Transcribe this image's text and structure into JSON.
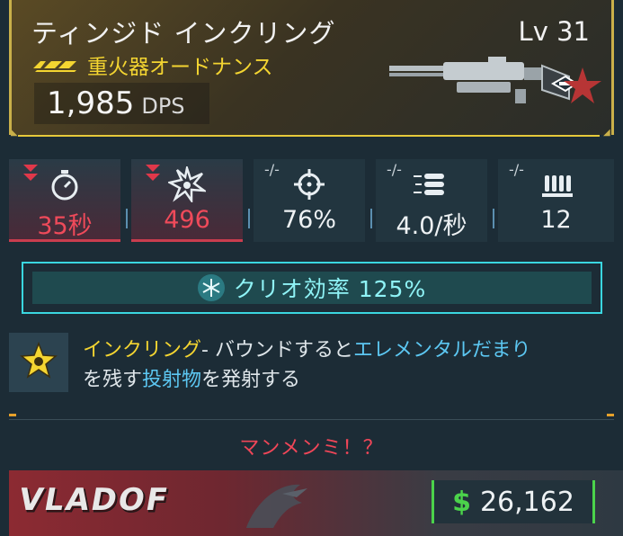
{
  "header": {
    "title": "ティンジド インクリング",
    "level": "Lv 31",
    "rarity_label": "重火器オードナンス",
    "dps_value": "1,985",
    "dps_unit": "DPS",
    "accent_color": "#e6c93a"
  },
  "stats": [
    {
      "id": "reload",
      "indicator": "down",
      "icon": "stopwatch-icon",
      "value": "35秒"
    },
    {
      "id": "damage",
      "indicator": "down",
      "icon": "burst-icon",
      "value": "496"
    },
    {
      "id": "accuracy",
      "indicator": "-/-",
      "icon": "crosshair-icon",
      "value": "76%"
    },
    {
      "id": "fire_rate",
      "indicator": "-/-",
      "icon": "bullets-icon",
      "value": "4.0/秒"
    },
    {
      "id": "magazine",
      "indicator": "-/-",
      "icon": "magazine-icon",
      "value": "12"
    }
  ],
  "element": {
    "icon": "cryo-snowflake-icon",
    "label": "クリオ効率 125%"
  },
  "perk": {
    "icon": "star-burst-icon",
    "name": "インクリング",
    "text_1": "- バウンドすると",
    "keyword_1": "エレメンタルだまり",
    "text_2": "を残す",
    "keyword_2": "投射物",
    "text_3": "を発射する"
  },
  "flavor_text": "マンメンミ！？",
  "footer": {
    "brand": "VLADOF",
    "currency_symbol": "$",
    "price": "26,162"
  }
}
